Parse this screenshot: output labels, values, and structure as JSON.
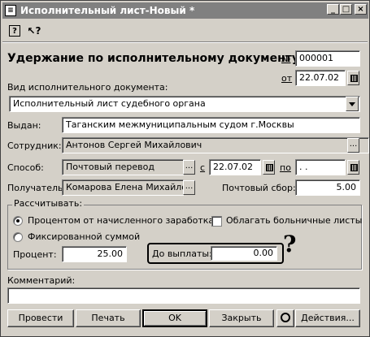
{
  "window": {
    "title": "Исполнительный лист-Новый *",
    "min_glyph": "_",
    "max_glyph": "□",
    "close_glyph": "×"
  },
  "toolbar": {
    "help_glyph": "?",
    "whatsthis_glyph": "↖?"
  },
  "form": {
    "heading": "Удержание по исполнительному документу",
    "number_label": "№",
    "number_value": "000001",
    "date_label": "от",
    "date_value": "22.07.02",
    "doc_type_label": "Вид исполнительного документа:",
    "doc_type_value": "Исполнительный лист судебного органа",
    "issued_label": "Выдан:",
    "issued_value": "Таганским межмуниципальным судом г.Москвы",
    "employee_label": "Сотрудник:",
    "employee_value": "Антонов Сергей Михайлович",
    "method_label": "Способ:",
    "method_value": "Почтовый перевод",
    "from_label": "с",
    "from_value": "22.07.02",
    "to_label": "по",
    "to_value": " .  .",
    "recipient_label": "Получатель:",
    "recipient_value": "Комарова Елена Михайлов",
    "postal_fee_label": "Почтовый сбор:",
    "postal_fee_value": "5.00",
    "ellipsis": "..."
  },
  "calc": {
    "group_label": "Рассчитывать:",
    "option_percent": "Процентом от начисленного заработка",
    "option_fixed": "Фиксированной суммой",
    "sick_leave_label": "Облагать больничные листы",
    "percent_label": "Процент:",
    "percent_value": "25.00",
    "payout_label": "До выплаты:",
    "payout_value": "0.00",
    "question_mark": "?"
  },
  "comment": {
    "label": "Комментарий:",
    "value": ""
  },
  "buttons": {
    "post": "Провести",
    "print": "Печать",
    "ok": "OK",
    "close": "Закрыть",
    "actions": "Действия..."
  }
}
